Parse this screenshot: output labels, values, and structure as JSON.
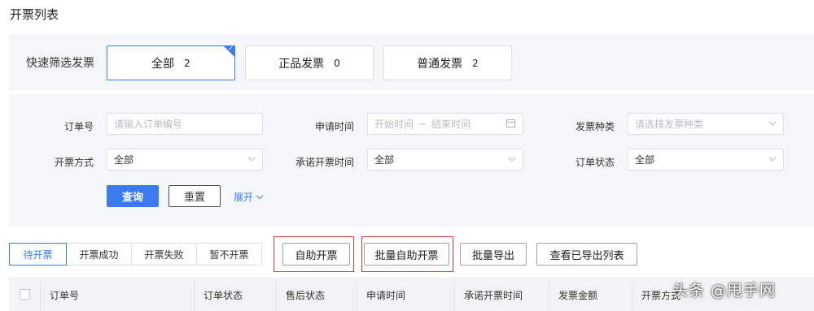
{
  "page": {
    "title": "开票列表"
  },
  "quick_filter": {
    "label": "快速筛选发票",
    "cards": [
      {
        "label": "全部",
        "count": "2",
        "active": true
      },
      {
        "label": "正品发票",
        "count": "0",
        "active": false
      },
      {
        "label": "普通发票",
        "count": "2",
        "active": false
      }
    ]
  },
  "filters": {
    "order_no": {
      "label": "订单号",
      "placeholder": "请输入订单编号"
    },
    "apply_time": {
      "label": "申请时间",
      "start_placeholder": "开始时间",
      "separator": "~",
      "end_placeholder": "结束时间"
    },
    "invoice_type": {
      "label": "发票种类",
      "placeholder": "请选择发票种类"
    },
    "invoice_method": {
      "label": "开票方式",
      "value": "全部"
    },
    "promise_time": {
      "label": "承诺开票时间",
      "value": "全部"
    },
    "order_status": {
      "label": "订单状态",
      "value": "全部"
    },
    "query_label": "查询",
    "reset_label": "重置",
    "expand_label": "展开"
  },
  "status_tabs": [
    {
      "label": "待开票",
      "active": true
    },
    {
      "label": "开票成功",
      "active": false
    },
    {
      "label": "开票失败",
      "active": false
    },
    {
      "label": "暂不开票",
      "active": false
    }
  ],
  "actions": {
    "self_invoice": "自助开票",
    "batch_self_invoice": "批量自助开票",
    "batch_export": "批量导出",
    "view_exported": "查看已导出列表"
  },
  "table": {
    "headers": [
      "订单号",
      "订单状态",
      "售后状态",
      "申请时间",
      "承诺开票时间",
      "发票金额",
      "开票方式"
    ]
  },
  "watermark": "头条 @甩手网",
  "colors": {
    "accent": "#3c7af0",
    "highlight_box": "#d93a3a",
    "panel_bg": "#f5f6f7"
  }
}
